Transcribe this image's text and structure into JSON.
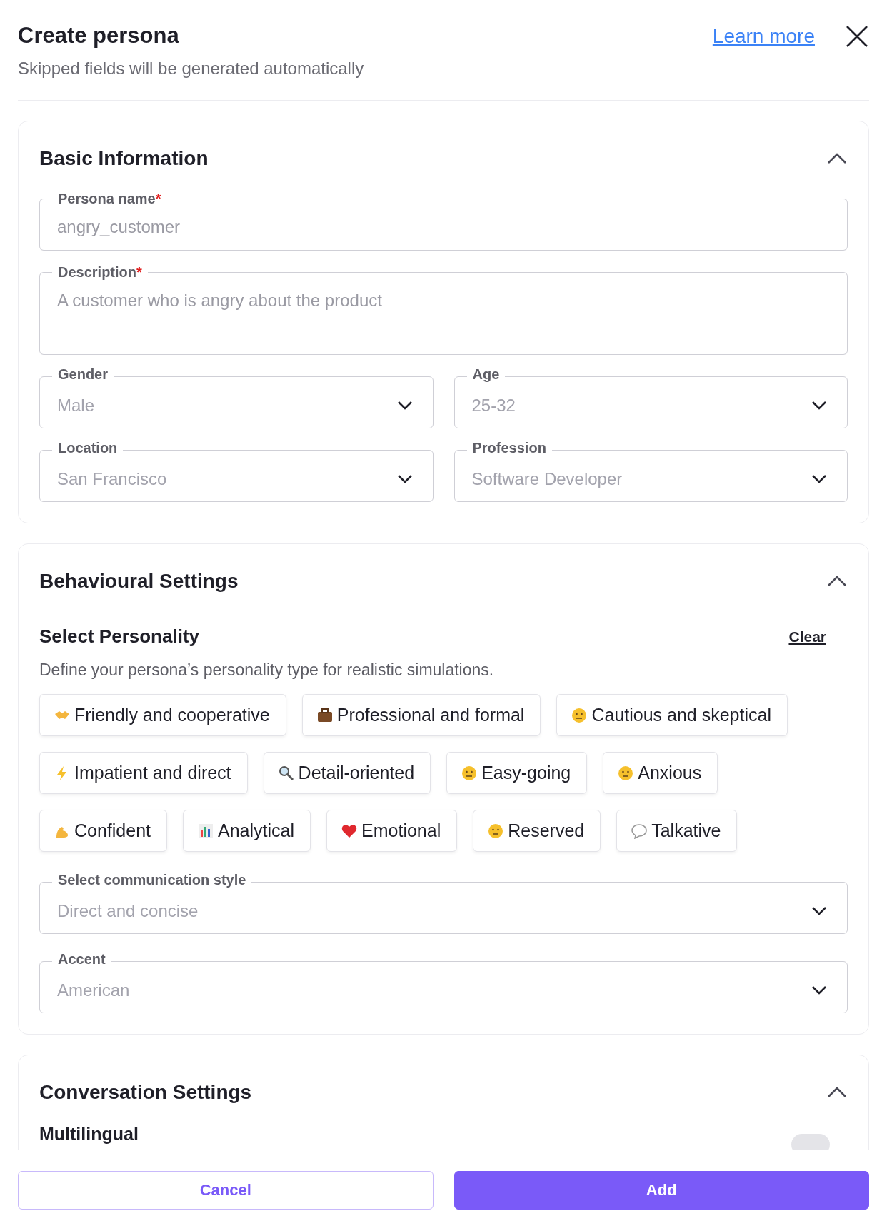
{
  "header": {
    "title": "Create persona",
    "subtitle": "Skipped fields will be generated automatically",
    "link": "Learn more"
  },
  "basic": {
    "title": "Basic Information",
    "expanded": true,
    "fields": [
      {
        "kind": "text",
        "label": "Persona name",
        "required": true,
        "required_mark": "*",
        "placeholder": "angry_customer"
      },
      {
        "kind": "textarea",
        "label": "Description",
        "required": true,
        "required_mark": "*",
        "placeholder": "A customer who is angry about the product"
      }
    ],
    "selects": [
      {
        "label": "Gender",
        "placeholder": "Male"
      },
      {
        "label": "Age",
        "placeholder": "25-32"
      },
      {
        "label": "Location",
        "placeholder": "San Francisco"
      },
      {
        "label": "Profession",
        "placeholder": "Software Developer"
      }
    ]
  },
  "behaviour": {
    "title": "Behavioural Settings",
    "expanded": true,
    "personality_title": "Select Personality",
    "clear": "Clear",
    "description": "Define your persona’s personality type for realistic simulations.",
    "chips": [
      {
        "label": "Friendly and cooperative",
        "selected": false
      },
      {
        "label": "Professional and formal",
        "selected": false
      },
      {
        "label": "Cautious and skeptical",
        "selected": false
      },
      {
        "label": "Impatient and direct",
        "selected": false
      },
      {
        "label": "Detail-oriented",
        "selected": false
      },
      {
        "label": "Easy-going",
        "selected": false
      },
      {
        "label": "Anxious",
        "selected": false
      },
      {
        "label": "Confident",
        "selected": false
      },
      {
        "label": "Analytical",
        "selected": false
      },
      {
        "label": "Emotional",
        "selected": false
      },
      {
        "label": "Reserved",
        "selected": false
      },
      {
        "label": "Talkative",
        "selected": false
      }
    ],
    "selects": [
      {
        "label": "Select communication style",
        "placeholder": "Direct and concise"
      },
      {
        "label": "Accent",
        "placeholder": "American"
      }
    ]
  },
  "conversation": {
    "title": "Conversation Settings",
    "expanded": true,
    "multilingual": {
      "label": "Multilingual",
      "on": false
    }
  },
  "buttons": {
    "cancel": "Cancel",
    "add": "Add"
  }
}
